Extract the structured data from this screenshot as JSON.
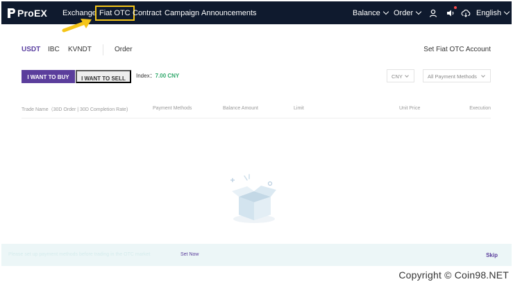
{
  "nav": {
    "logo_text": "ProEX",
    "items": [
      {
        "label": "Exchange"
      },
      {
        "label": "Fiat OTC"
      },
      {
        "label": "Contract"
      },
      {
        "label": "Campaign"
      },
      {
        "label": "Announcements"
      }
    ],
    "balance_label": "Balance",
    "order_label": "Order",
    "language_label": "English",
    "icons": [
      "user-icon",
      "speaker-icon",
      "download-icon"
    ]
  },
  "tabs": [
    {
      "label": "USDT"
    },
    {
      "label": "IBC"
    },
    {
      "label": "KVNDT"
    },
    {
      "label": "Order"
    }
  ],
  "set_fiat_label": "Set Fiat OTC Account",
  "actions": {
    "buy_label": "I WANT TO BUY",
    "sell_label": "I WANT TO SELL"
  },
  "index": {
    "label": "Index：",
    "value": "7.00 CNY"
  },
  "filters": {
    "currency": "CNY",
    "payment": "All Payment Methods"
  },
  "table": {
    "headers": [
      "Trade Name（30D Order | 30D Completion Rate)",
      "Payment Methods",
      "Balance Amount",
      "Limit",
      "Unit Price",
      "Execution"
    ]
  },
  "banner": {
    "message": "Please set up payment methods before trading in the OTC market",
    "link_label": "Set Now",
    "skip_label": "Skip"
  },
  "copyright": "Copyright © Coin98.NET",
  "colors": {
    "nav_bg": "#0f1a2e",
    "accent": "#5b3e9c",
    "highlight": "#f5c518",
    "index_green": "#2fa86a"
  }
}
